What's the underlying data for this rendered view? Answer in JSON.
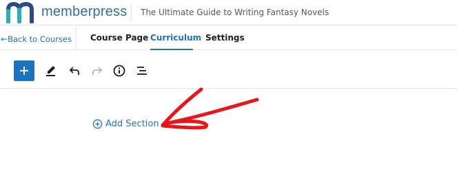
{
  "header": {
    "brand": "memberpress",
    "course_title": "The Ultimate Guide to Writing Fantasy Novels"
  },
  "nav": {
    "back_arrow": "←",
    "back_label": "Back to Courses",
    "tabs": [
      {
        "label": "Course Page",
        "active": false
      },
      {
        "label": "Curriculum",
        "active": true
      },
      {
        "label": "Settings",
        "active": false
      }
    ]
  },
  "toolbar": {
    "tools": [
      "add-block",
      "edit",
      "undo",
      "redo",
      "info",
      "list-view"
    ]
  },
  "content": {
    "add_section_label": "Add Section"
  },
  "colors": {
    "accent": "#2271b1",
    "brand_teal": "#28b0c0",
    "brand_navy": "#2b4c7e",
    "add_button": "#1e73be",
    "annotation": "#e8151b"
  }
}
